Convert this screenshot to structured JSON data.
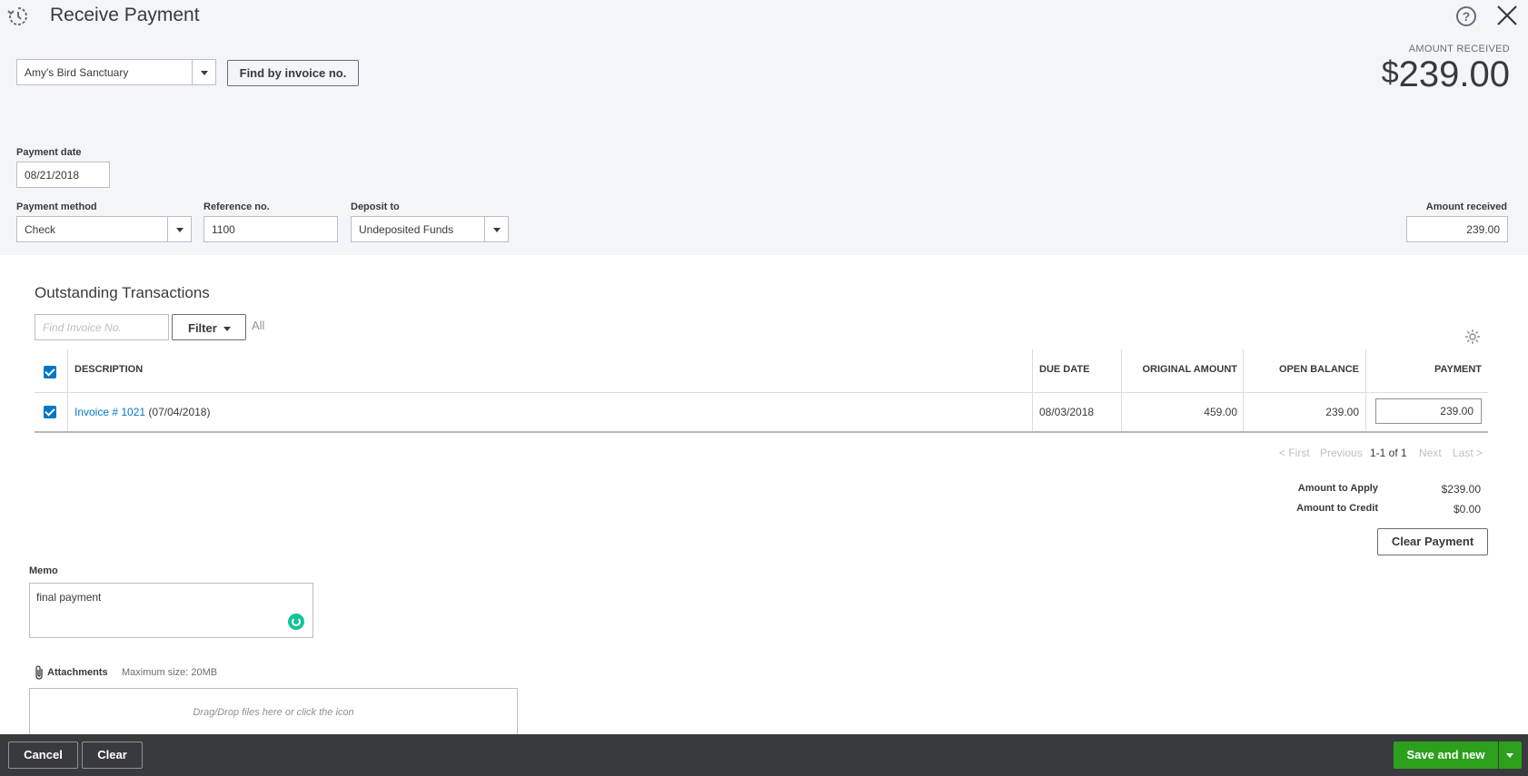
{
  "header": {
    "title": "Receive Payment",
    "history_icon": "clock-history-icon",
    "help_icon": "help-icon",
    "close_icon": "close-icon",
    "help_glyph": "?"
  },
  "customer": {
    "selected": "Amy's Bird Sanctuary",
    "find_invoice_label": "Find by invoice no."
  },
  "amount_received_caption": "AMOUNT RECEIVED",
  "amount_received_display": {
    "currency": "$",
    "value": "239.00"
  },
  "payment_date": {
    "label": "Payment date",
    "value": "08/21/2018"
  },
  "payment_method": {
    "label": "Payment method",
    "value": "Check"
  },
  "reference_no": {
    "label": "Reference no.",
    "value": "1100"
  },
  "deposit_to": {
    "label": "Deposit to",
    "value": "Undeposited Funds"
  },
  "amount_received_field": {
    "label": "Amount received",
    "value": "239.00"
  },
  "outstanding": {
    "title": "Outstanding Transactions",
    "find_placeholder": "Find Invoice No.",
    "filter_label": "Filter",
    "all_label": "All",
    "columns": {
      "description": "DESCRIPTION",
      "due_date": "DUE DATE",
      "original_amount": "ORIGINAL AMOUNT",
      "open_balance": "OPEN BALANCE",
      "payment": "PAYMENT"
    },
    "rows": [
      {
        "checked": true,
        "link": "Invoice # 1021",
        "date_suffix": "(07/04/2018)",
        "due_date": "08/03/2018",
        "original_amount": "459.00",
        "open_balance": "239.00",
        "payment": "239.00"
      }
    ],
    "pager": {
      "first": "< First",
      "previous": "Previous",
      "range": "1-1 of 1",
      "next": "Next",
      "last": "Last >"
    }
  },
  "summary": {
    "amount_to_apply_label": "Amount to Apply",
    "amount_to_apply": "$239.00",
    "amount_to_credit_label": "Amount to Credit",
    "amount_to_credit": "$0.00",
    "clear_payment_label": "Clear Payment"
  },
  "memo": {
    "label": "Memo",
    "value": "final payment"
  },
  "attachments": {
    "label": "Attachments",
    "max_size": "Maximum size: 20MB",
    "dropzone_text": "Drag/Drop files here or click the icon"
  },
  "footer": {
    "cancel_label": "Cancel",
    "clear_label": "Clear",
    "save_new_label": "Save and new"
  },
  "colors": {
    "accent_green": "#2ca01c",
    "link_blue": "#0077c5",
    "footer_bg": "#393a3d",
    "top_panel_bg": "#f4f5f8"
  }
}
